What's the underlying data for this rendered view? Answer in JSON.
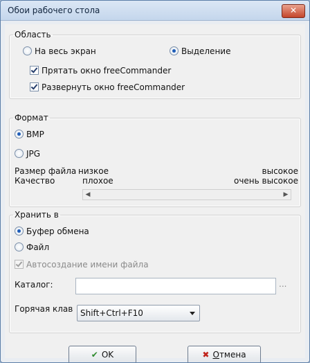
{
  "window": {
    "title": "Обои рабочего стола",
    "close_label": "✕"
  },
  "area": {
    "legend": "Область",
    "radio_full": "На весь экран",
    "radio_selection": "Выделение",
    "check_hide": "Прятать окно freeCommander",
    "check_expand": "Развернуть окно freeCommander"
  },
  "format": {
    "legend": "Формат",
    "radio_bmp": "BMP",
    "radio_jpg": "JPG",
    "size_label": "Размер файла",
    "size_low": "низкое",
    "size_high": "высокое",
    "quality_label": "Качество",
    "quality_low": "плохое",
    "quality_high": "очень высокое"
  },
  "store": {
    "legend": "Хранить в",
    "radio_clipboard": "Буфер обмена",
    "radio_file": "Файл",
    "check_autoname": "Автосоздание имени файла",
    "catalog_label": "Каталог:",
    "catalog_value": "",
    "browse_label": "...",
    "hotkey_label": "Горячая клав",
    "hotkey_value": "Shift+Ctrl+F10"
  },
  "buttons": {
    "ok": "OK",
    "cancel_first": "О",
    "cancel_rest": "тмена"
  }
}
